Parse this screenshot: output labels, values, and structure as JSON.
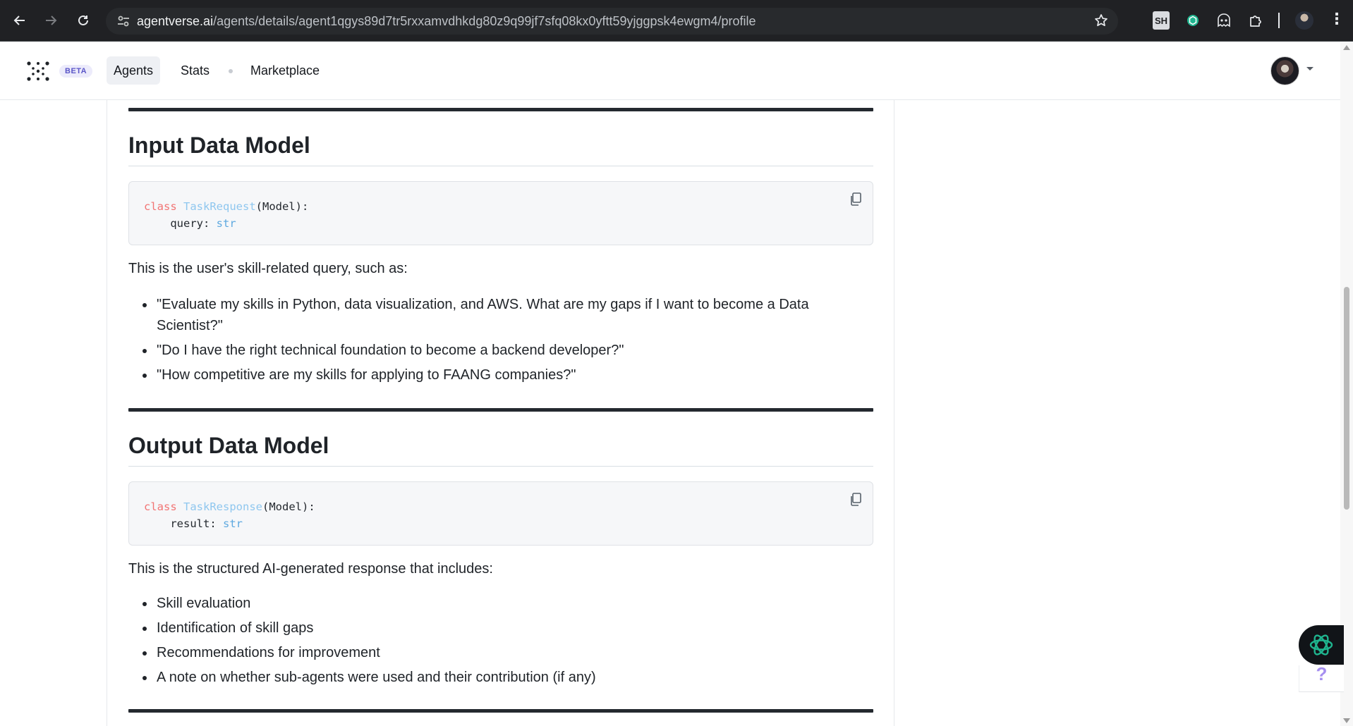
{
  "browser": {
    "url_host": "agentverse.ai",
    "url_path": "/agents/details/agent1qgys89d7tr5rxxamvdhkdg80z9q99jf7sfq08kx0yftt59yjggpsk4ewgm4/profile",
    "extension_sh_label": "SH",
    "icons": [
      "back-arrow-icon",
      "forward-arrow-icon",
      "reload-icon",
      "site-settings-icon",
      "star-icon",
      "chatgpt-icon",
      "ghost-icon",
      "puzzle-icon",
      "kebab-menu-icon"
    ]
  },
  "header": {
    "beta_label": "BETA",
    "nav": {
      "agents": "Agents",
      "stats": "Stats",
      "marketplace": "Marketplace"
    }
  },
  "sections": {
    "input": {
      "title": "Input Data Model",
      "code": {
        "keyword": "class",
        "class_name": "TaskRequest",
        "base": "(Model):",
        "field_name": "    query: ",
        "field_type": "str"
      },
      "description": "This is the user's skill-related query, such as:",
      "examples": [
        "\"Evaluate my skills in Python, data visualization, and AWS. What are my gaps if I want to become a Data Scientist?\"",
        "\"Do I have the right technical foundation to become a backend developer?\"",
        "\"How competitive are my skills for applying to FAANG companies?\""
      ]
    },
    "output": {
      "title": "Output Data Model",
      "code": {
        "keyword": "class",
        "class_name": "TaskResponse",
        "base": "(Model):",
        "field_name": "    result: ",
        "field_type": "str"
      },
      "description": "This is the structured AI-generated response that includes:",
      "items": [
        "Skill evaluation",
        "Identification of skill gaps",
        "Recommendations for improvement",
        "A note on whether sub-agents were used and their contribution (if any)"
      ]
    }
  },
  "widget": {
    "help_label": "?"
  },
  "colors": {
    "chrome_bg": "#202124",
    "keyword": "#f27474",
    "class_name": "#8fc7ef",
    "type": "#5fa9e0",
    "beta_badge_bg": "#ecebfb",
    "beta_badge_text": "#5b56c8",
    "widget_bg": "#111418",
    "widget_icon": "#1fb58f",
    "help_icon": "#a68ff0"
  }
}
